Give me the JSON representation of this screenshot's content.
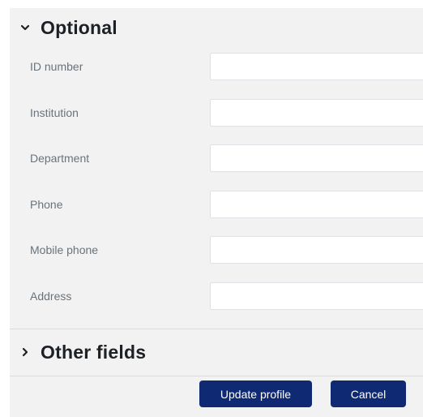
{
  "sections": {
    "optional": {
      "title": "Optional",
      "expanded": true
    },
    "other_fields": {
      "title": "Other fields",
      "expanded": false
    }
  },
  "fields": [
    {
      "label": "ID number",
      "value": "",
      "placeholder": ""
    },
    {
      "label": "Institution",
      "value": "",
      "placeholder": ""
    },
    {
      "label": "Department",
      "value": "",
      "placeholder": ""
    },
    {
      "label": "Phone",
      "value": "",
      "placeholder": ""
    },
    {
      "label": "Mobile phone",
      "value": "",
      "placeholder": ""
    },
    {
      "label": "Address",
      "value": "",
      "placeholder": ""
    }
  ],
  "actions": {
    "update_label": "Update profile",
    "cancel_label": "Cancel"
  },
  "icons": {
    "expanded": "chevron-down-icon",
    "collapsed": "chevron-right-icon"
  },
  "colors": {
    "panel_background": "#f2f2f2",
    "button_primary": "#0f2a73",
    "label_text": "#6a737b",
    "heading_text": "#1d2125"
  }
}
